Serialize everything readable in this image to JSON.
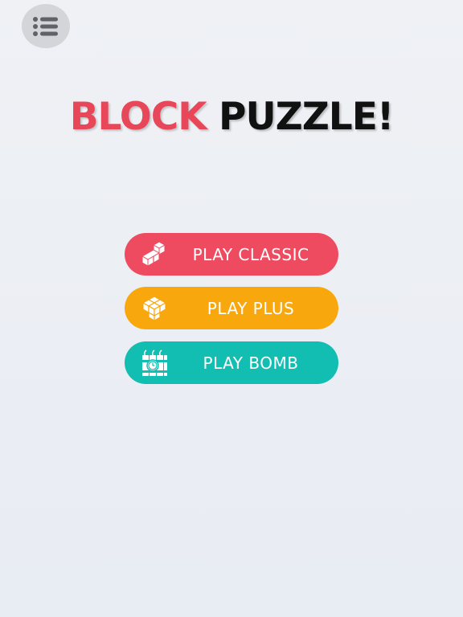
{
  "header": {
    "menu_icon": "list-menu-icon"
  },
  "title": {
    "word_1": "BLOCK",
    "word_2": "PUZZLE!",
    "word_1_color": "#e8475a",
    "word_2_color": "#111111"
  },
  "modes": [
    {
      "label": "PLAY CLASSIC",
      "color": "#ef4b60",
      "icon": "l-block-icon"
    },
    {
      "label": "PLAY PLUS",
      "color": "#f8a70d",
      "icon": "plus-block-icon"
    },
    {
      "label": "PLAY BOMB",
      "color": "#12bdb2",
      "icon": "bomb-block-icon"
    }
  ]
}
